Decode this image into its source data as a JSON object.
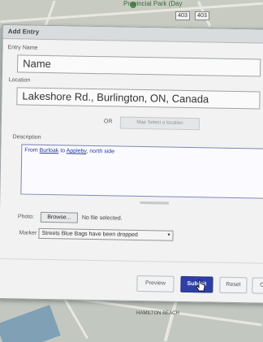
{
  "map": {
    "park_label": "Provincial Park (Day",
    "shield_1": "403",
    "shield_2": "403",
    "hamilton_label": "HAMILTON BEACH"
  },
  "dialog": {
    "title": "Add Entry",
    "entry_name_label": "Entry Name",
    "entry_name_value": "Name",
    "location_label": "Location",
    "location_value": "Lakeshore Rd., Burlington, ON, Canada",
    "or_label": "OR",
    "map_select_label": "Map Select a location",
    "description_label": "Description",
    "description_prefix": "From ",
    "description_link1": "Burloak",
    "description_mid": " to ",
    "description_link2": "Appleby",
    "description_suffix": ", north side",
    "photo_label": "Photo:",
    "browse_label": "Browse...",
    "no_file_text": "No file selected.",
    "marker_label": "Marker",
    "marker_value": "Streets Blue Bags have been dropped",
    "buttons": {
      "preview": "Preview",
      "submit": "Submit",
      "reset": "Reset",
      "close": "Clo"
    }
  },
  "colors": {
    "primary": "#2f3fa8",
    "link": "#2a3d9a"
  }
}
